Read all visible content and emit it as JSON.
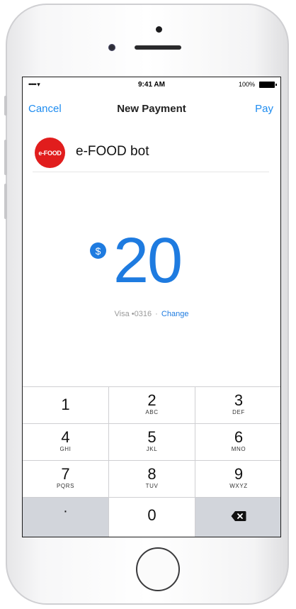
{
  "status_bar": {
    "signal": "•••••",
    "wifi": "▾",
    "time": "9:41 AM",
    "battery": "100%"
  },
  "nav": {
    "cancel_label": "Cancel",
    "title": "New Payment",
    "pay_label": "Pay"
  },
  "recipient": {
    "logo_text": "e-FOOD",
    "name": "e-FOOD bot",
    "logo_color": "#e11d1d"
  },
  "payment": {
    "currency_symbol": "$",
    "amount": "20",
    "card_label": "Visa •0316",
    "separator": "·",
    "change_label": "Change",
    "accent_color": "#1e7be0"
  },
  "keypad": {
    "keys": [
      {
        "num": "1",
        "letters": ""
      },
      {
        "num": "2",
        "letters": "ABC"
      },
      {
        "num": "3",
        "letters": "DEF"
      },
      {
        "num": "4",
        "letters": "GHI"
      },
      {
        "num": "5",
        "letters": "JKL"
      },
      {
        "num": "6",
        "letters": "MNO"
      },
      {
        "num": "7",
        "letters": "PQRS"
      },
      {
        "num": "8",
        "letters": "TUV"
      },
      {
        "num": "9",
        "letters": "WXYZ"
      },
      {
        "num": "·",
        "letters": ""
      },
      {
        "num": "0",
        "letters": ""
      },
      {
        "num": "",
        "letters": "",
        "icon": "backspace-icon"
      }
    ]
  }
}
